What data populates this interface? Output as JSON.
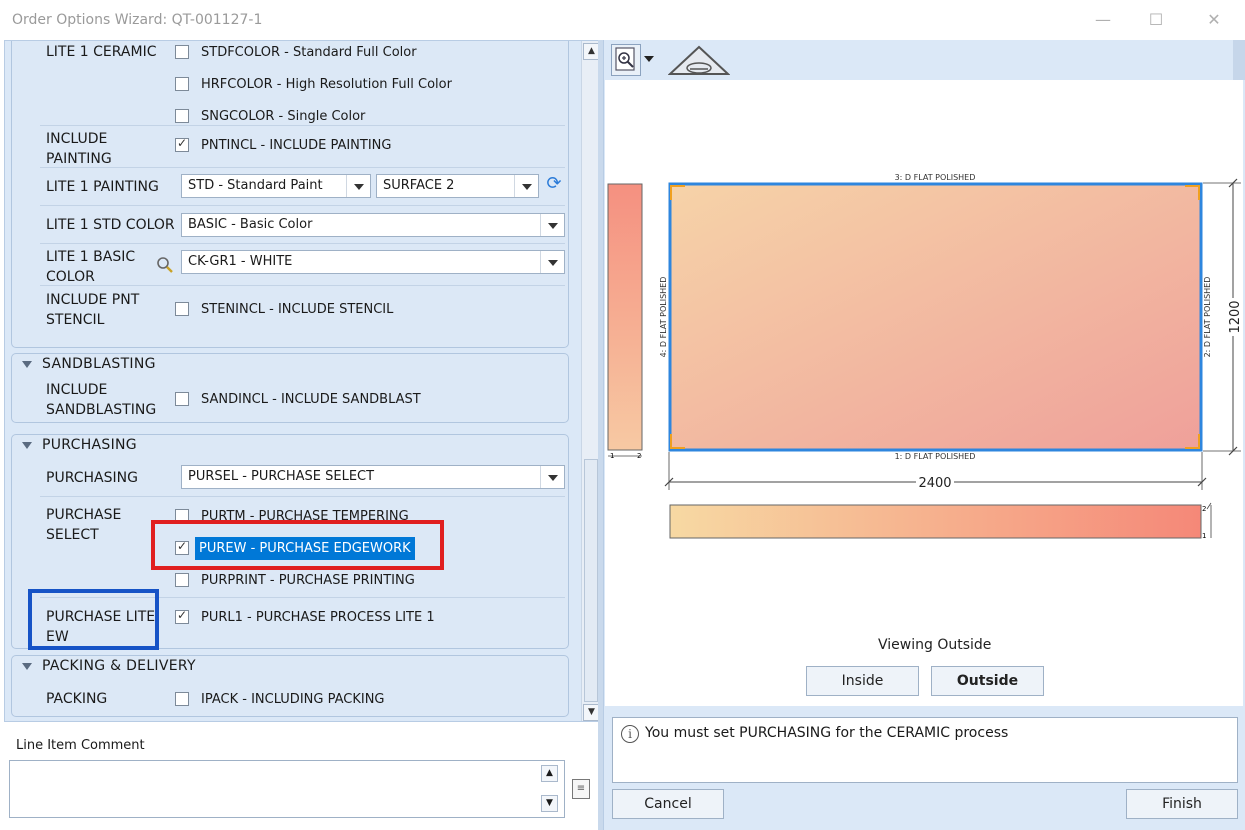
{
  "window": {
    "title": "Order Options Wizard: QT-001127-1",
    "minimize": "—",
    "maximize": "☐",
    "close": "✕"
  },
  "groups": {
    "lite1": {
      "rows": {
        "ceramic": {
          "label": "LITE 1 CERAMIC",
          "options": [
            {
              "text": "STDFCOLOR - Standard Full Color",
              "checked": false
            },
            {
              "text": "HRFCOLOR - High Resolution Full Color",
              "checked": false
            },
            {
              "text": "SNGCOLOR - Single Color",
              "checked": false
            }
          ]
        },
        "include_painting": {
          "label_line1": "INCLUDE",
          "label_line2": "PAINTING",
          "option": {
            "text": "PNTINCL - INCLUDE PAINTING",
            "checked": true
          }
        },
        "painting": {
          "label": "LITE 1 PAINTING",
          "dropdown1": "STD - Standard Paint",
          "dropdown2": "SURFACE 2"
        },
        "std_color": {
          "label": "LITE 1 STD COLOR",
          "dropdown": "BASIC - Basic Color"
        },
        "basic_color": {
          "label_line1": "LITE 1 BASIC",
          "label_line2": "COLOR",
          "dropdown": "CK-GR1 - WHITE"
        },
        "pnt_stencil": {
          "label_line1": "INCLUDE PNT",
          "label_line2": "STENCIL",
          "option": {
            "text": "STENINCL - INCLUDE STENCIL",
            "checked": false
          }
        }
      }
    },
    "sandblasting": {
      "header": "SANDBLASTING",
      "label_line1": "INCLUDE",
      "label_line2": "SANDBLASTING",
      "option": {
        "text": "SANDINCL - INCLUDE SANDBLAST",
        "checked": false
      }
    },
    "purchasing": {
      "header": "PURCHASING",
      "purchasing_label": "PURCHASING",
      "purchasing_dropdown": "PURSEL - PURCHASE SELECT",
      "select_label_line1": "PURCHASE",
      "select_label_line2": "SELECT",
      "select_options": [
        {
          "text": "PURTM - PURCHASE TEMPERING",
          "checked": false
        },
        {
          "text": "PUREW - PURCHASE EDGEWORK",
          "checked": true
        },
        {
          "text": "PURPRINT - PURCHASE PRINTING",
          "checked": false
        }
      ],
      "lite_label_line1": "PURCHASE LITE",
      "lite_label_line2": "EW",
      "lite_option": {
        "text": "PURL1 - PURCHASE PROCESS LITE 1",
        "checked": true
      }
    },
    "packing": {
      "header": "PACKING & DELIVERY",
      "label": "PACKING",
      "option": {
        "text": "IPACK - INCLUDING PACKING",
        "checked": false
      }
    }
  },
  "comment": {
    "label": "Line Item Comment",
    "value": ""
  },
  "drawing": {
    "top_edge": "3: D    FLAT POLISHED",
    "bottom_edge": "1: D    FLAT POLISHED",
    "left_edge": "4: D    FLAT POLISHED",
    "right_edge": "2: D    FLAT POLISHED",
    "width": "2400",
    "height": "1200",
    "side_tick_1": "1",
    "side_tick_2": "2",
    "bottom_tick_1": "1",
    "bottom_tick_2": "2"
  },
  "view": {
    "status": "Viewing Outside",
    "inside_label": "Inside",
    "outside_label": "Outside"
  },
  "message": {
    "text": "You must set PURCHASING for the CERAMIC process"
  },
  "footer": {
    "cancel_label": "Cancel",
    "finish_label": "Finish"
  },
  "colors": {
    "accent": "#0078d7",
    "red_highlight": "#e01f1f",
    "blue_highlight": "#1653c6",
    "pane_bg": "#dbe8f7"
  }
}
